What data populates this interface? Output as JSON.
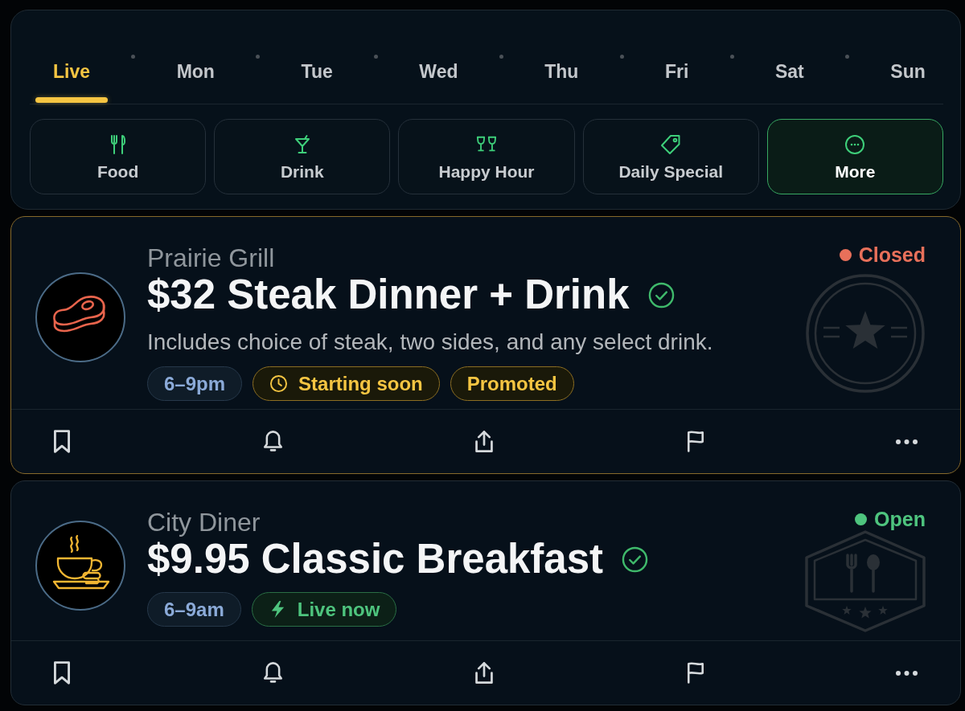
{
  "day_tabs": [
    {
      "label": "Live",
      "selected": true
    },
    {
      "label": "Mon",
      "selected": false
    },
    {
      "label": "Tue",
      "selected": false
    },
    {
      "label": "Wed",
      "selected": false
    },
    {
      "label": "Thu",
      "selected": false
    },
    {
      "label": "Fri",
      "selected": false
    },
    {
      "label": "Sat",
      "selected": false
    },
    {
      "label": "Sun",
      "selected": false
    }
  ],
  "categories": [
    {
      "kind": "food",
      "label": "Food",
      "selected": false
    },
    {
      "kind": "drink",
      "label": "Drink",
      "selected": false
    },
    {
      "kind": "happyhour",
      "label": "Happy Hour",
      "selected": false
    },
    {
      "kind": "special",
      "label": "Daily Special",
      "selected": false
    },
    {
      "kind": "more",
      "label": "More",
      "selected": true
    }
  ],
  "deals": [
    {
      "kind": "dinner",
      "featured": true,
      "restaurant": "Prairie Grill",
      "title": "$32 Steak Dinner + Drink",
      "verified": true,
      "description": "Includes choice of steak, two sides, and any select drink.",
      "tags": [
        {
          "kind": "time",
          "label": "6–9pm"
        },
        {
          "kind": "upcoming",
          "label": "Starting soon"
        },
        {
          "kind": "promoted",
          "label": "Promoted"
        }
      ],
      "status": {
        "label": "Closed",
        "open": false
      }
    },
    {
      "kind": "breakfast",
      "featured": false,
      "restaurant": "City Diner",
      "title": "$9.95 Classic Breakfast",
      "verified": true,
      "tags": [
        {
          "kind": "time",
          "label": "6–9am"
        },
        {
          "kind": "live",
          "label": "Live now"
        }
      ],
      "status": {
        "label": "Open",
        "open": true
      }
    }
  ]
}
